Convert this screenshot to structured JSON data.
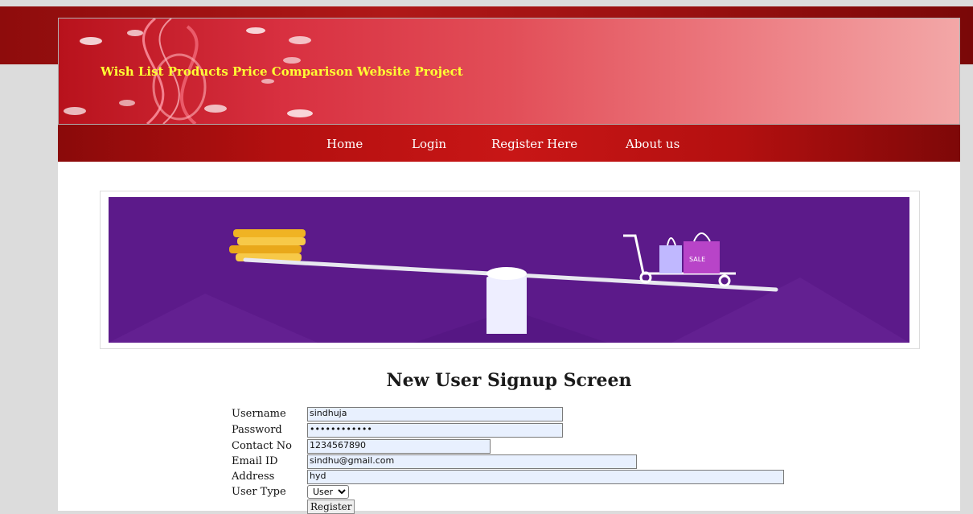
{
  "site": {
    "title": "Wish List Products Price Comparison Website Project"
  },
  "nav": {
    "items": [
      "Home",
      "Login",
      "Register Here",
      "About us"
    ]
  },
  "banner": {
    "description": "purple-seesaw-coins-vs-shopping-cart-illustration",
    "sale_tag": "SALE"
  },
  "form": {
    "title": "New User Signup Screen",
    "username_label": "Username",
    "username_value": "sindhuja",
    "password_label": "Password",
    "password_value": "••••••••••••",
    "contact_label": "Contact No",
    "contact_value": "1234567890",
    "email_label": "Email ID",
    "email_value": "sindhu@gmail.com",
    "address_label": "Address",
    "address_value": "hyd",
    "usertype_label": "User Type",
    "usertype_selected": "User",
    "register_label": "Register"
  },
  "colors": {
    "nav_bg": "#b41010",
    "header_title": "#ffff33",
    "banner_bg": "#5c1a8a",
    "field_bg": "#e8f0fe"
  }
}
